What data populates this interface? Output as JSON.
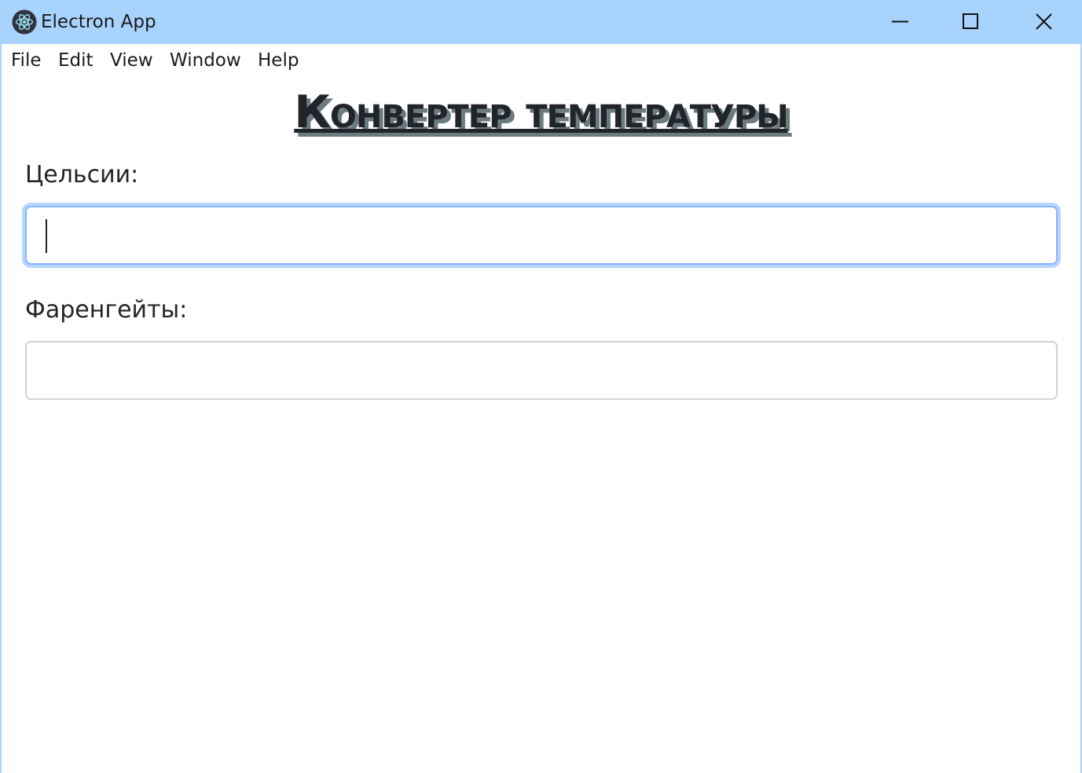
{
  "window": {
    "title": "Electron App",
    "icon": "electron-atom-icon",
    "controls": [
      "minimize-icon",
      "maximize-icon",
      "close-icon"
    ],
    "titlebar_color": "#a9d3ff"
  },
  "menu": {
    "file": "File",
    "edit": "Edit",
    "view": "View",
    "window": "Window",
    "help": "Help"
  },
  "page": {
    "heading": "Конвертер температуры",
    "celsius_label": "Цельсии:",
    "celsius_value": "",
    "fahrenheit_label": "Фаренгейты:",
    "fahrenheit_value": ""
  },
  "colors": {
    "focus_border": "#86b7fe",
    "focus_ring": "#b6d6ff",
    "heading_text": "#212529",
    "heading_shadow": "#6c7b7d"
  }
}
